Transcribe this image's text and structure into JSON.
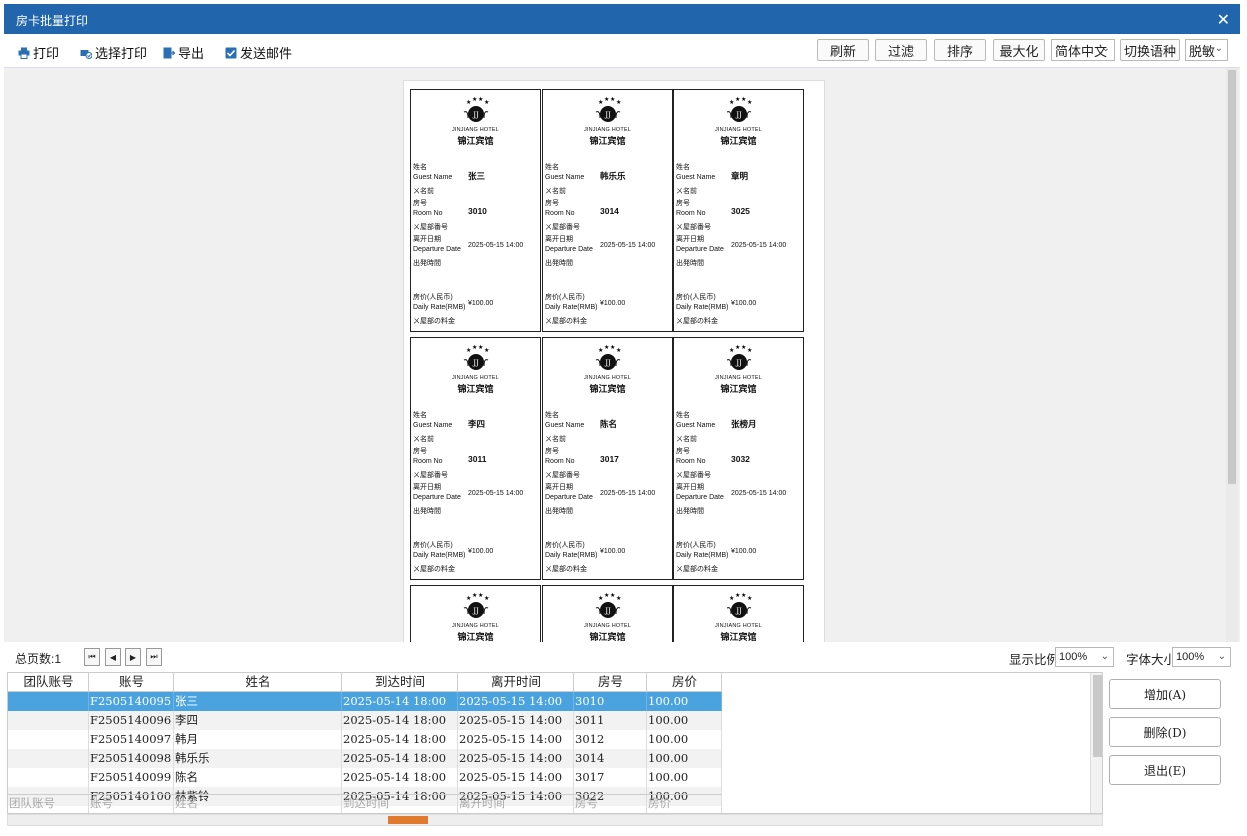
{
  "window": {
    "title": "房卡批量打印",
    "close_glyph": "✕"
  },
  "toolbar": {
    "print": "打印",
    "select_print": "选择打印",
    "export": "导出",
    "send_mail": "发送邮件",
    "refresh": "刷新",
    "filter": "过滤",
    "sort": "排序",
    "maximize": "最大化",
    "language_value": "简体中文",
    "switch_language": "切换语种",
    "mask_value": "脱敏"
  },
  "card_template": {
    "logo_en": "JINJIANG HOTEL",
    "logo_cn": "锦江宾馆",
    "name_cn": "姓名",
    "name_en": "Guest Name",
    "name_alt": "ㄨ名前",
    "room_cn": "房号",
    "room_en": "Room No",
    "room_alt": "ㄨ屋部番号",
    "dep_cn": "离开日期",
    "dep_en": "Departure Date",
    "dep_alt": "出発時間",
    "rate_cn": "房价(人民币)",
    "rate_en": "Daily Rate(RMB)",
    "rate_alt": "ㄨ屋部の料金"
  },
  "cards": [
    {
      "name": "张三",
      "room": "3010",
      "departure": "2025-05-15 14:00",
      "rate": "¥100.00"
    },
    {
      "name": "韩乐乐",
      "room": "3014",
      "departure": "2025-05-15 14:00",
      "rate": "¥100.00"
    },
    {
      "name": "章明",
      "room": "3025",
      "departure": "2025-05-15 14:00",
      "rate": "¥100.00"
    },
    {
      "name": "李四",
      "room": "3011",
      "departure": "2025-05-15 14:00",
      "rate": "¥100.00"
    },
    {
      "name": "陈名",
      "room": "3017",
      "departure": "2025-05-15 14:00",
      "rate": "¥100.00"
    },
    {
      "name": "张榜月",
      "room": "3032",
      "departure": "2025-05-15 14:00",
      "rate": "¥100.00"
    },
    {
      "name": "",
      "room": "",
      "departure": "",
      "rate": ""
    },
    {
      "name": "",
      "room": "",
      "departure": "",
      "rate": ""
    },
    {
      "name": "",
      "room": "",
      "departure": "",
      "rate": ""
    }
  ],
  "pagebar": {
    "total_pages_label": "总页数:1",
    "zoom_label": "显示比例",
    "zoom_value": "100%",
    "font_label": "字体大小",
    "font_value": "100%"
  },
  "table": {
    "columns": [
      "团队账号",
      "账号",
      "姓名",
      "到达时间",
      "离开时间",
      "房号",
      "房价"
    ],
    "rows": [
      [
        "",
        "F2505140095",
        "张三",
        "2025-05-14 18:00",
        "2025-05-15 14:00",
        "3010",
        "100.00"
      ],
      [
        "",
        "F2505140096",
        "李四",
        "2025-05-14 18:00",
        "2025-05-15 14:00",
        "3011",
        "100.00"
      ],
      [
        "",
        "F2505140097",
        "韩月",
        "2025-05-14 18:00",
        "2025-05-15 14:00",
        "3012",
        "100.00"
      ],
      [
        "",
        "F2505140098",
        "韩乐乐",
        "2025-05-14 18:00",
        "2025-05-15 14:00",
        "3014",
        "100.00"
      ],
      [
        "",
        "F2505140099",
        "陈名",
        "2025-05-14 18:00",
        "2025-05-15 14:00",
        "3017",
        "100.00"
      ],
      [
        "",
        "F2505140100",
        "林紫铃",
        "2025-05-14 18:00",
        "2025-05-15 14:00",
        "3022",
        "100.00"
      ]
    ],
    "filter_placeholders": [
      "团队账号",
      "账号",
      "姓名",
      "到达时间",
      "离开时间",
      "房号",
      "房价"
    ]
  },
  "side": {
    "add": "增加(A)",
    "delete": "删除(D)",
    "exit": "退出(E)"
  }
}
